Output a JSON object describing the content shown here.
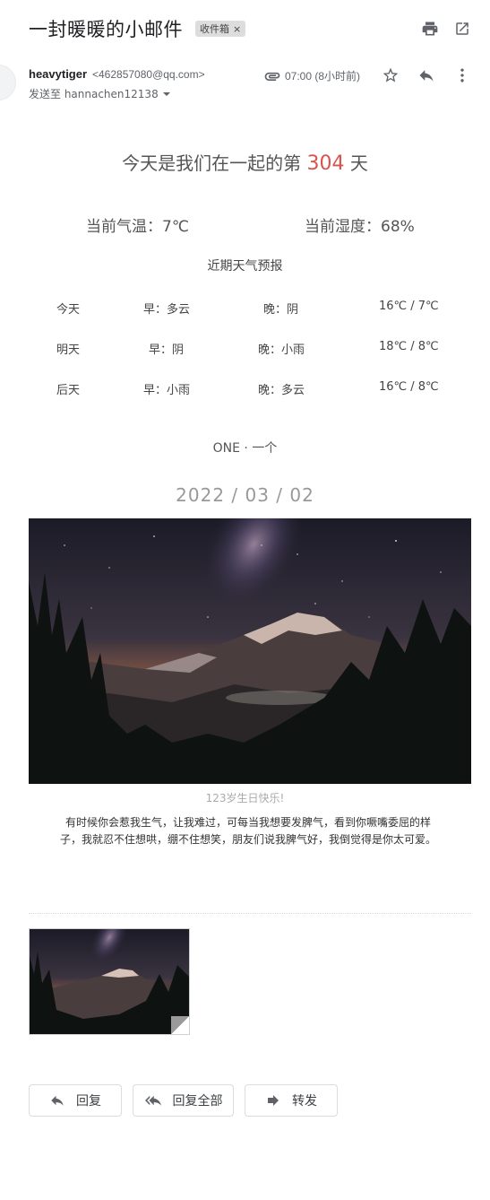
{
  "header": {
    "subject": "一封暖暖的小邮件",
    "label": "收件箱",
    "label_remove": "×",
    "icons": [
      "print-icon",
      "open-in-new-window-icon"
    ]
  },
  "sender": {
    "name": "heavytiger",
    "email": "<462857080@qq.com>",
    "to_line": "发送至 hannachen12138",
    "time": "07:00 (8小时前)",
    "icons": [
      "attachment-icon",
      "star-icon",
      "reply-icon",
      "more-vert-icon"
    ]
  },
  "body": {
    "together_prefix": "今天是我们在一起的第 ",
    "together_days": "304",
    "together_suffix": " 天",
    "temperature": "当前气温：7℃",
    "humidity": "当前湿度：68%",
    "forecast_title": "近期天气预报",
    "forecast": [
      {
        "day": "今天",
        "am": "早：多云",
        "pm": "晚：阴",
        "temp": "16℃ / 7℃"
      },
      {
        "day": "明天",
        "am": "早：阴",
        "pm": "晚：小雨",
        "temp": "18℃ / 8℃"
      },
      {
        "day": "后天",
        "am": "早：小雨",
        "pm": "晚：多云",
        "temp": "16℃ / 8℃"
      }
    ],
    "one_title": "ONE · 一个",
    "one_date": "2022 / 03 / 02",
    "photo_caption": "123岁生日快乐!",
    "quote": "有时候你会惹我生气，让我难过，可每当我想要发脾气，看到你噘嘴委屈的样子，我就忍不住想哄，绷不住想笑，朋友们说我脾气好，我倒觉得是你太可爱。"
  },
  "actions": {
    "reply": "回复",
    "reply_all": "回复全部",
    "forward": "转发"
  },
  "colors": {
    "accent_red": "#d9534f",
    "text_gray": "#5f6368",
    "chip_bg": "#dddddd"
  }
}
